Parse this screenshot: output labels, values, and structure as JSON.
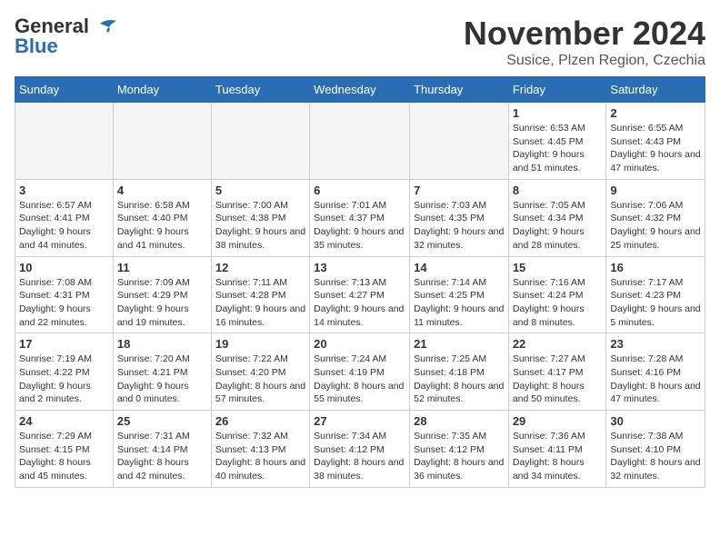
{
  "header": {
    "logo_line1": "General",
    "logo_line2": "Blue",
    "month": "November 2024",
    "location": "Susice, Plzen Region, Czechia"
  },
  "days_of_week": [
    "Sunday",
    "Monday",
    "Tuesday",
    "Wednesday",
    "Thursday",
    "Friday",
    "Saturday"
  ],
  "weeks": [
    [
      {
        "day": "",
        "info": ""
      },
      {
        "day": "",
        "info": ""
      },
      {
        "day": "",
        "info": ""
      },
      {
        "day": "",
        "info": ""
      },
      {
        "day": "",
        "info": ""
      },
      {
        "day": "1",
        "info": "Sunrise: 6:53 AM\nSunset: 4:45 PM\nDaylight: 9 hours and 51 minutes."
      },
      {
        "day": "2",
        "info": "Sunrise: 6:55 AM\nSunset: 4:43 PM\nDaylight: 9 hours and 47 minutes."
      }
    ],
    [
      {
        "day": "3",
        "info": "Sunrise: 6:57 AM\nSunset: 4:41 PM\nDaylight: 9 hours and 44 minutes."
      },
      {
        "day": "4",
        "info": "Sunrise: 6:58 AM\nSunset: 4:40 PM\nDaylight: 9 hours and 41 minutes."
      },
      {
        "day": "5",
        "info": "Sunrise: 7:00 AM\nSunset: 4:38 PM\nDaylight: 9 hours and 38 minutes."
      },
      {
        "day": "6",
        "info": "Sunrise: 7:01 AM\nSunset: 4:37 PM\nDaylight: 9 hours and 35 minutes."
      },
      {
        "day": "7",
        "info": "Sunrise: 7:03 AM\nSunset: 4:35 PM\nDaylight: 9 hours and 32 minutes."
      },
      {
        "day": "8",
        "info": "Sunrise: 7:05 AM\nSunset: 4:34 PM\nDaylight: 9 hours and 28 minutes."
      },
      {
        "day": "9",
        "info": "Sunrise: 7:06 AM\nSunset: 4:32 PM\nDaylight: 9 hours and 25 minutes."
      }
    ],
    [
      {
        "day": "10",
        "info": "Sunrise: 7:08 AM\nSunset: 4:31 PM\nDaylight: 9 hours and 22 minutes."
      },
      {
        "day": "11",
        "info": "Sunrise: 7:09 AM\nSunset: 4:29 PM\nDaylight: 9 hours and 19 minutes."
      },
      {
        "day": "12",
        "info": "Sunrise: 7:11 AM\nSunset: 4:28 PM\nDaylight: 9 hours and 16 minutes."
      },
      {
        "day": "13",
        "info": "Sunrise: 7:13 AM\nSunset: 4:27 PM\nDaylight: 9 hours and 14 minutes."
      },
      {
        "day": "14",
        "info": "Sunrise: 7:14 AM\nSunset: 4:25 PM\nDaylight: 9 hours and 11 minutes."
      },
      {
        "day": "15",
        "info": "Sunrise: 7:16 AM\nSunset: 4:24 PM\nDaylight: 9 hours and 8 minutes."
      },
      {
        "day": "16",
        "info": "Sunrise: 7:17 AM\nSunset: 4:23 PM\nDaylight: 9 hours and 5 minutes."
      }
    ],
    [
      {
        "day": "17",
        "info": "Sunrise: 7:19 AM\nSunset: 4:22 PM\nDaylight: 9 hours and 2 minutes."
      },
      {
        "day": "18",
        "info": "Sunrise: 7:20 AM\nSunset: 4:21 PM\nDaylight: 9 hours and 0 minutes."
      },
      {
        "day": "19",
        "info": "Sunrise: 7:22 AM\nSunset: 4:20 PM\nDaylight: 8 hours and 57 minutes."
      },
      {
        "day": "20",
        "info": "Sunrise: 7:24 AM\nSunset: 4:19 PM\nDaylight: 8 hours and 55 minutes."
      },
      {
        "day": "21",
        "info": "Sunrise: 7:25 AM\nSunset: 4:18 PM\nDaylight: 8 hours and 52 minutes."
      },
      {
        "day": "22",
        "info": "Sunrise: 7:27 AM\nSunset: 4:17 PM\nDaylight: 8 hours and 50 minutes."
      },
      {
        "day": "23",
        "info": "Sunrise: 7:28 AM\nSunset: 4:16 PM\nDaylight: 8 hours and 47 minutes."
      }
    ],
    [
      {
        "day": "24",
        "info": "Sunrise: 7:29 AM\nSunset: 4:15 PM\nDaylight: 8 hours and 45 minutes."
      },
      {
        "day": "25",
        "info": "Sunrise: 7:31 AM\nSunset: 4:14 PM\nDaylight: 8 hours and 42 minutes."
      },
      {
        "day": "26",
        "info": "Sunrise: 7:32 AM\nSunset: 4:13 PM\nDaylight: 8 hours and 40 minutes."
      },
      {
        "day": "27",
        "info": "Sunrise: 7:34 AM\nSunset: 4:12 PM\nDaylight: 8 hours and 38 minutes."
      },
      {
        "day": "28",
        "info": "Sunrise: 7:35 AM\nSunset: 4:12 PM\nDaylight: 8 hours and 36 minutes."
      },
      {
        "day": "29",
        "info": "Sunrise: 7:36 AM\nSunset: 4:11 PM\nDaylight: 8 hours and 34 minutes."
      },
      {
        "day": "30",
        "info": "Sunrise: 7:38 AM\nSunset: 4:10 PM\nDaylight: 8 hours and 32 minutes."
      }
    ]
  ]
}
